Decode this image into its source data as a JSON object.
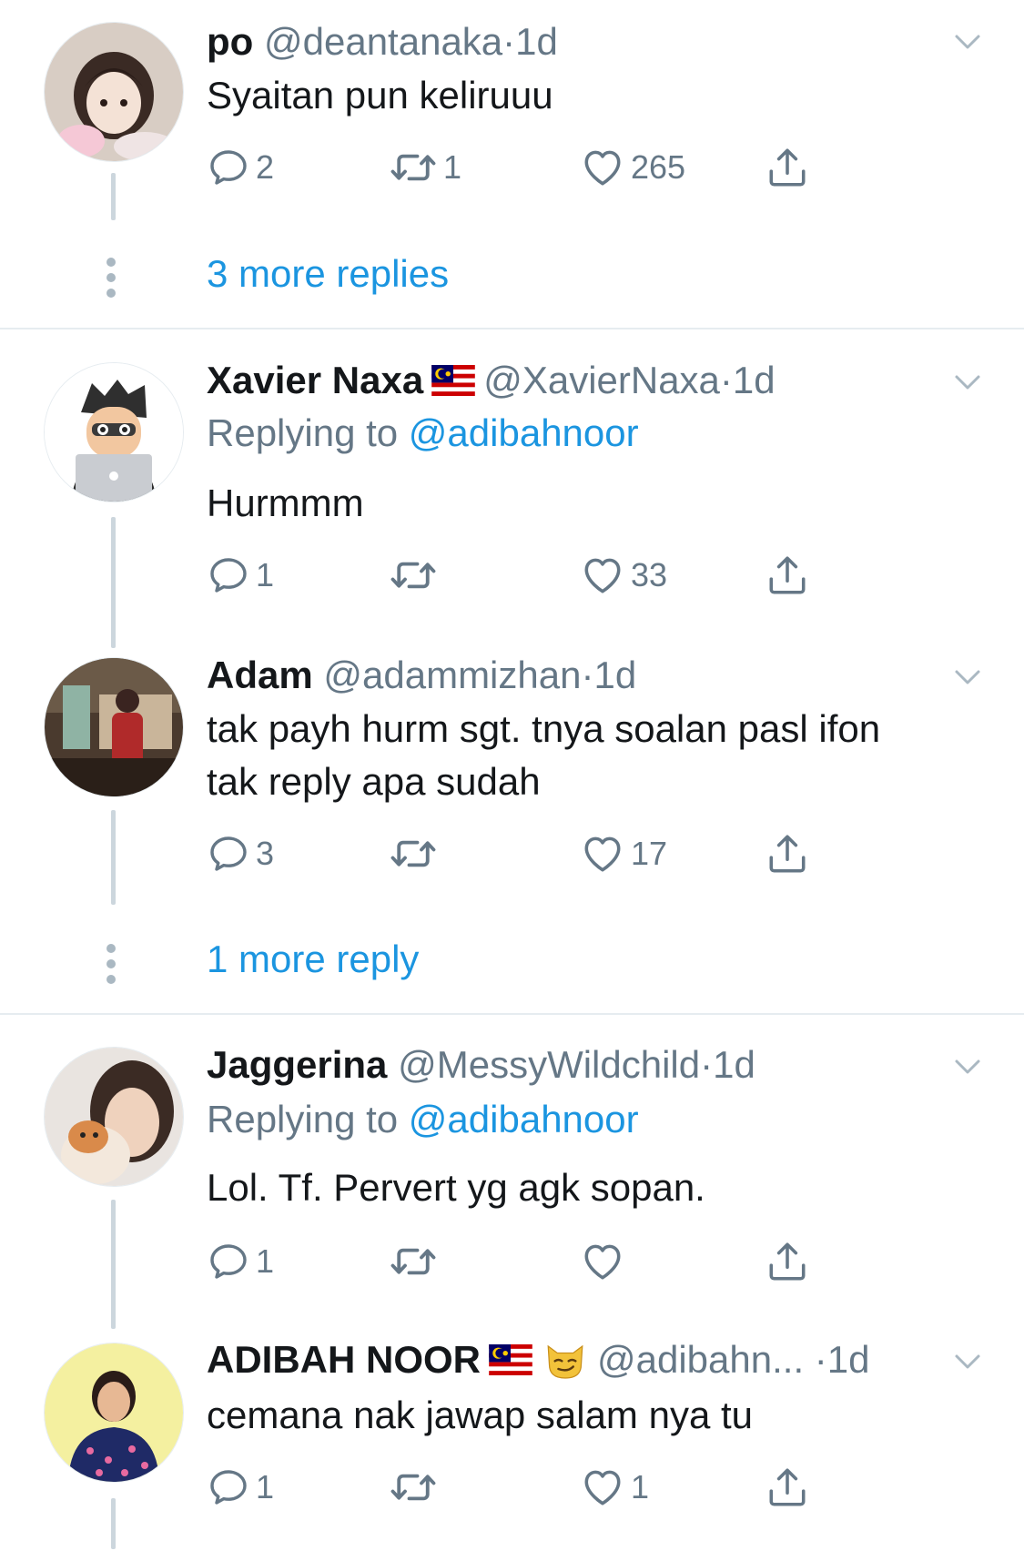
{
  "tweets": [
    {
      "name": "po",
      "handle": "@deantanaka",
      "dot": "·",
      "time": "1d",
      "text": "Syaitan pun keliruuu",
      "replies": "2",
      "retweets": "1",
      "likes": "265"
    },
    {
      "name": "Xavier Naxa",
      "handle": "@XavierNaxa",
      "dot": "·",
      "time": "1d",
      "replying_prefix": "Replying to",
      "replying_to": "@adibahnoor",
      "text": "Hurmmm",
      "replies": "1",
      "retweets": "",
      "likes": "33"
    },
    {
      "name": "Adam",
      "handle": "@adammizhan",
      "dot": "·",
      "time": "1d",
      "text_line1": "tak payh hurm sgt. tnya soalan pasl ifon",
      "text_line2": "tak reply apa sudah",
      "replies": "3",
      "retweets": "",
      "likes": "17"
    },
    {
      "name": "Jaggerina",
      "handle": "@MessyWildchild",
      "dot": "·",
      "time": "1d",
      "replying_prefix": "Replying to",
      "replying_to": "@adibahnoor",
      "text": "Lol. Tf. Pervert yg agk sopan.",
      "replies": "1",
      "retweets": "",
      "likes": ""
    },
    {
      "name": "ADIBAH NOOR",
      "handle": "@adibahn...",
      "dot": "·",
      "time": "1d",
      "text": "cemana nak jawap salam nya tu",
      "replies": "1",
      "retweets": "",
      "likes": "1"
    }
  ],
  "more_replies_1": "3 more replies",
  "more_replies_2": "1 more reply",
  "icons": {
    "reply": "reply-icon",
    "retweet": "retweet-icon",
    "like": "heart-icon",
    "share": "share-icon",
    "caret": "chevron-down-icon",
    "flag": "malaysia-flag-icon",
    "emoji": "smirking-cat-emoji"
  },
  "colors": {
    "link": "#1b95e0",
    "secondary": "#657786",
    "thread_line": "#ccd6dd",
    "divider": "#e6ecf0"
  }
}
